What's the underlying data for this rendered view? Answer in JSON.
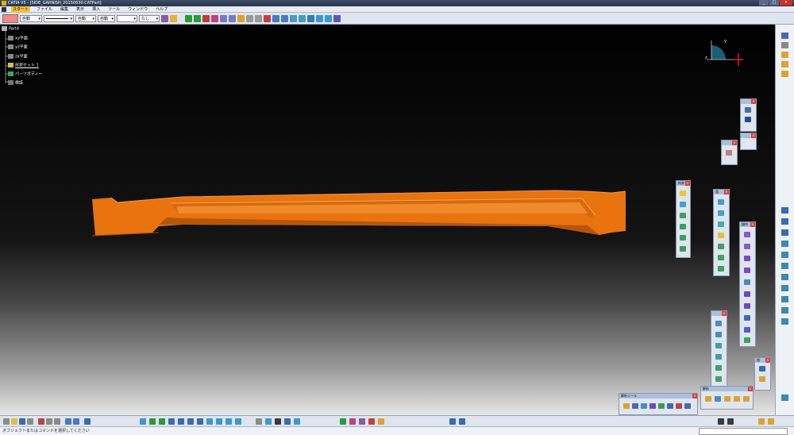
{
  "window": {
    "title": "CATIA V5 - [SIDE_GARNISH_20150630.CATPart]",
    "buttons": [
      "_",
      "□",
      "×"
    ]
  },
  "menubar": {
    "items": [
      "スタート",
      "ファイル",
      "編集",
      "表示",
      "挿入",
      "ツール",
      "ウィンドウ",
      "ヘルプ"
    ]
  },
  "toolbar": {
    "fill_color": "#f08a8a",
    "color_dropdown": "自動",
    "line_dropdown": "",
    "weight_dropdown": "自動",
    "layer_dropdown": "自動",
    "style_dropdown": "",
    "point_dropdown": "なし"
  },
  "tree": {
    "root": "Part4",
    "planes": [
      "xy平面",
      "yz平面",
      "zx平面"
    ],
    "body": "形状セット.1",
    "part_body": "パーツボディー",
    "extra": "検証"
  },
  "compass": {
    "x_label": "z",
    "y_label": "y"
  },
  "floating_toolbars": {
    "constraints": "拘束",
    "surfaces": "面",
    "operations": "操作",
    "analysis": "解析",
    "measure_title": "解析ツール",
    "sketch": "描"
  },
  "statusbar": {
    "message": "オブジェクトまたはコマンドを選択してください"
  },
  "colors": {
    "part": "#e8730f",
    "part_dark": "#b8550a",
    "part_light": "#f49a3c"
  }
}
